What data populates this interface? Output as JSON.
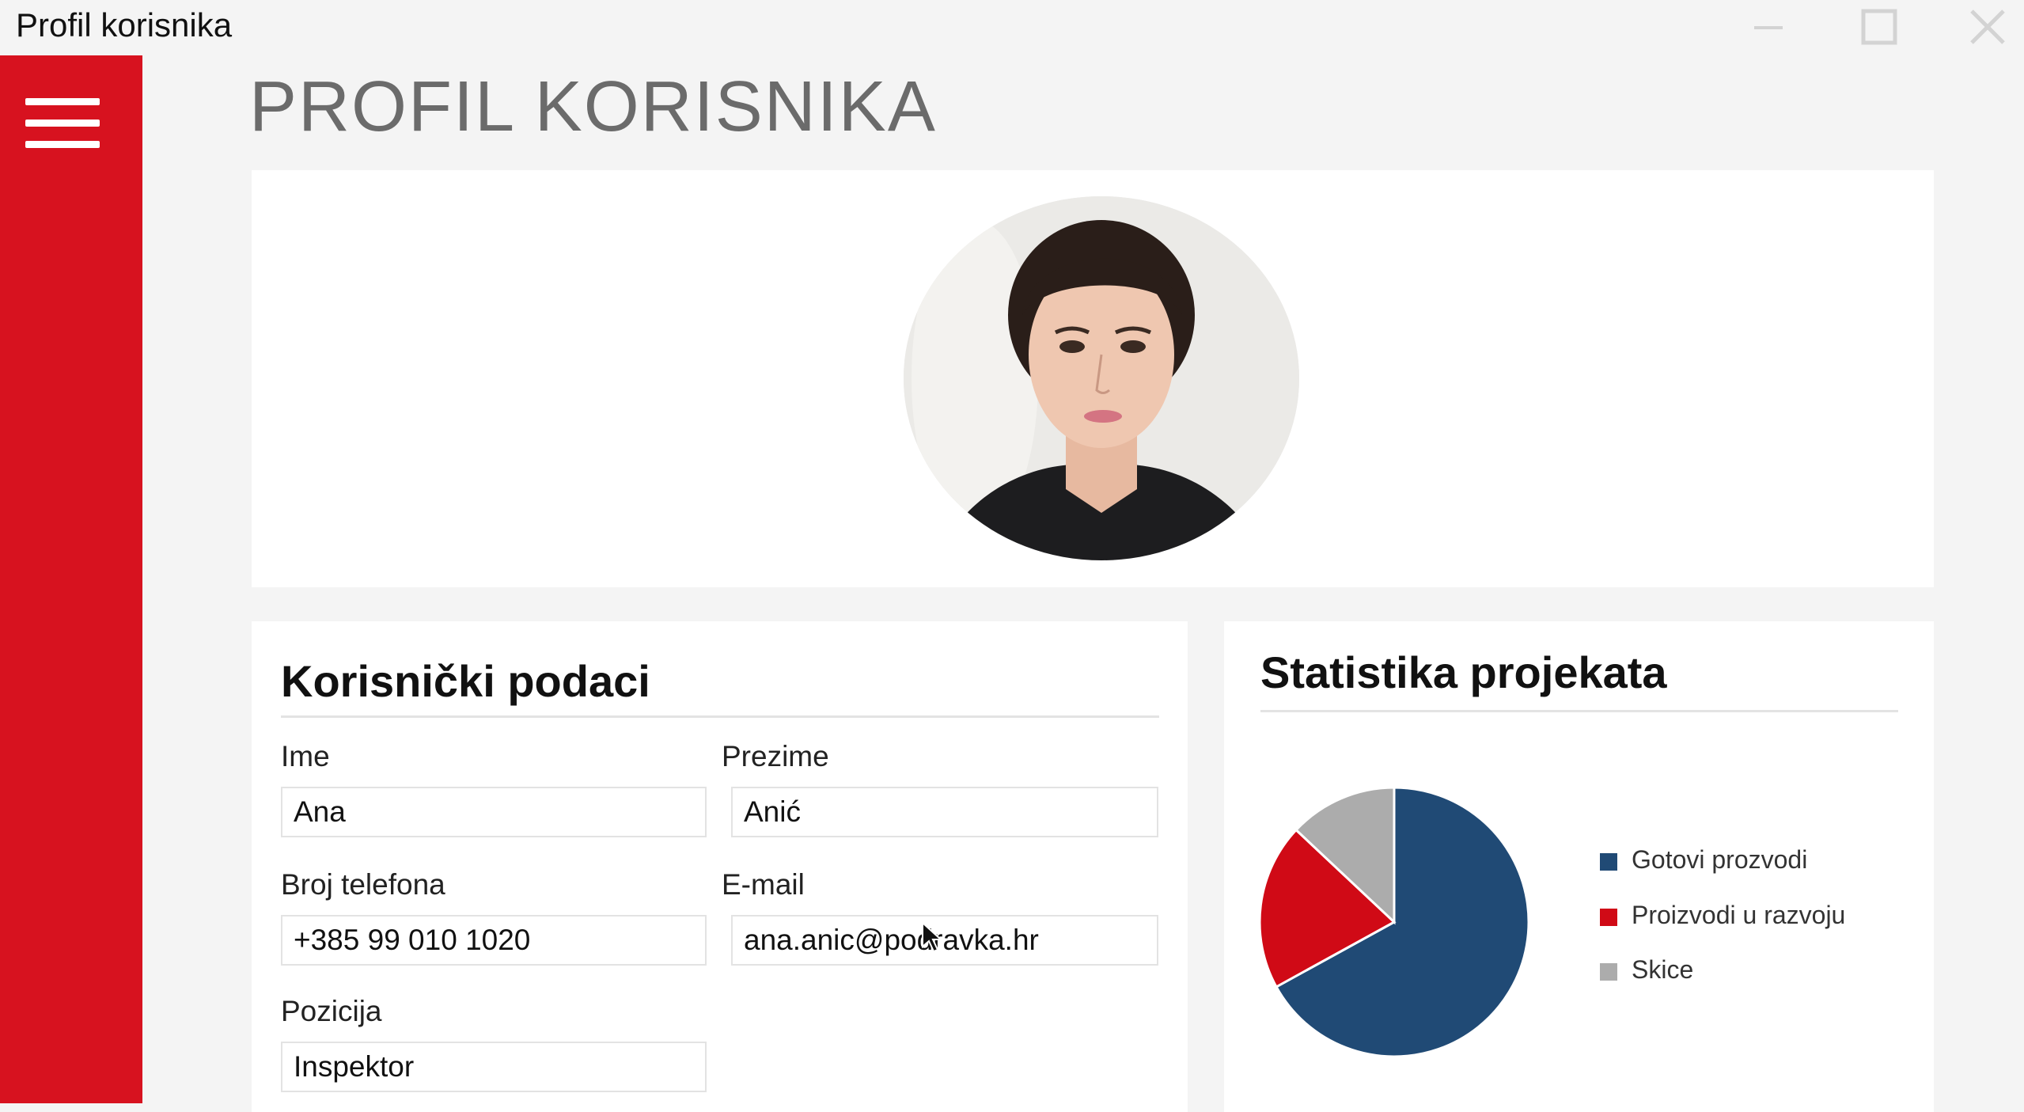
{
  "window": {
    "title": "Profil korisnika",
    "controls": {
      "minimize_icon": "minimize-icon",
      "maximize_icon": "maximize-icon",
      "close_icon": "close-icon"
    }
  },
  "sidebar": {
    "menu_icon": "hamburger-icon",
    "color": "#d7121f"
  },
  "page": {
    "title": "PROFIL KORISNIKA"
  },
  "profile": {
    "avatar": "user-portrait-photo"
  },
  "user_data": {
    "title": "Korisnički podaci",
    "fields": {
      "first_name": {
        "label": "Ime",
        "value": "Ana"
      },
      "last_name": {
        "label": "Prezime",
        "value": "Anić"
      },
      "phone": {
        "label": "Broj telefona",
        "value": "+385 99 010 1020"
      },
      "email": {
        "label": "E-mail",
        "value": "ana.anic@podravka.hr"
      },
      "position": {
        "label": "Pozicija",
        "value": "Inspektor"
      }
    }
  },
  "stats": {
    "title": "Statistika projekata",
    "legend": [
      {
        "label": "Gotovi prozvodi",
        "color": "#204a75"
      },
      {
        "label": "Proizvodi u razvoju",
        "color": "#d00a16"
      },
      {
        "label": "Skice",
        "color": "#acacac"
      }
    ]
  },
  "chart_data": {
    "type": "pie",
    "categories": [
      "Gotovi prozvodi",
      "Proizvodi u razvoju",
      "Skice"
    ],
    "values": [
      67,
      20,
      13
    ],
    "colors": [
      "#204a75",
      "#d00a16",
      "#acacac"
    ],
    "title": "Statistika projekata",
    "legend_position": "right"
  }
}
